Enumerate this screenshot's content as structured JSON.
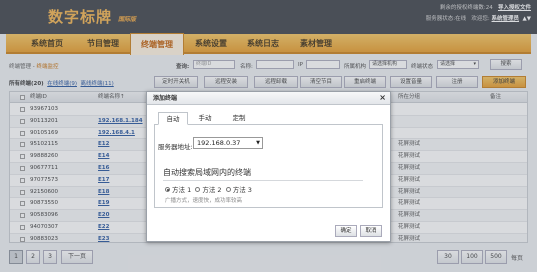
{
  "app": {
    "logo": "数字标牌",
    "logo_sub": "国际版",
    "online_count_text": "剩余的授权终端数:24",
    "import_license": "导入授权文件",
    "server_status": "服务器状态:在线",
    "welcome": "欢迎您:",
    "username": "系统管理员",
    "user_menu": "▲▼"
  },
  "nav": {
    "items": [
      {
        "label": "系统首页"
      },
      {
        "label": "节目管理"
      },
      {
        "label": "终端管理"
      },
      {
        "label": "系统设置"
      },
      {
        "label": "系统日志"
      },
      {
        "label": "素材管理"
      }
    ]
  },
  "breadcrumb": {
    "parent": "终端管理 -",
    "current": "终端监控"
  },
  "filter": {
    "label": "查询:",
    "terminal_id_placeholder": "终端ID",
    "name_label": "名称:",
    "ip_label": "IP",
    "group_label": "所属机构",
    "group_value": "请选择机构",
    "status_label": "终端状态",
    "status_value": "请选择",
    "search_button": "搜索"
  },
  "terminal_tabs": {
    "all": "所有终端(20)",
    "online": "在线终端(9)",
    "offline": "离线终端(11)"
  },
  "actions": [
    {
      "label": "定时开关机"
    },
    {
      "label": "远程安装"
    },
    {
      "label": "远程卸载"
    },
    {
      "label": "清空节目"
    },
    {
      "label": "重启终端"
    },
    {
      "label": "设置音量"
    },
    {
      "label": "注册"
    },
    {
      "label": "添加终端"
    }
  ],
  "table": {
    "headers": {
      "id": "终端ID",
      "name": "终端名称↑",
      "group": "所在分组",
      "remark": "备注"
    },
    "rows": [
      {
        "id": "93967103",
        "name": "",
        "group": ""
      },
      {
        "id": "90113201",
        "name": "192.168.1.184",
        "group": ""
      },
      {
        "id": "90105169",
        "name": "192.168.4.1",
        "group": ""
      },
      {
        "id": "95102115",
        "name": "E12",
        "group": "花屏测试"
      },
      {
        "id": "99888260",
        "name": "E14",
        "group": "花屏测试"
      },
      {
        "id": "90677711",
        "name": "E16",
        "group": "花屏测试"
      },
      {
        "id": "97077573",
        "name": "E17",
        "group": "花屏测试"
      },
      {
        "id": "92150600",
        "name": "E18",
        "group": "花屏测试"
      },
      {
        "id": "90873550",
        "name": "E19",
        "group": "花屏测试"
      },
      {
        "id": "90583096",
        "name": "E20",
        "group": "花屏测试"
      },
      {
        "id": "94070307",
        "name": "E22",
        "group": "花屏测试"
      },
      {
        "id": "90883023",
        "name": "E23",
        "group": "花屏测试"
      }
    ]
  },
  "pagination": {
    "pages": [
      "1",
      "2",
      "3"
    ],
    "next": "下一页",
    "sizes": [
      "30",
      "100",
      "500"
    ],
    "size_suffix": "每页"
  },
  "dialog": {
    "title": "添加终端",
    "close": "×",
    "tabs": [
      {
        "label": "自动"
      },
      {
        "label": "手动"
      },
      {
        "label": "定制"
      }
    ],
    "server_label": "服务器地址:",
    "server_value": "192.168.0.37",
    "auto_title": "自动搜索局域网内的终端",
    "methods": [
      "方法 1",
      "方法 2",
      "方法 3"
    ],
    "method_desc": "广播方式，速度快，成功率较高",
    "ok_button": "确定",
    "cancel_button": "取消"
  }
}
